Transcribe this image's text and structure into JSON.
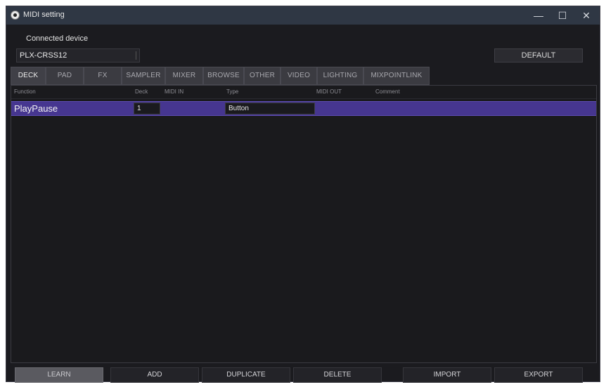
{
  "window": {
    "title": "MIDI setting",
    "controls": {
      "minimize": "—",
      "maximize": "☐",
      "close": "✕"
    }
  },
  "device": {
    "label": "Connected device",
    "value": "PLX-CRSS12",
    "default_button": "DEFAULT"
  },
  "tabs": [
    "DECK",
    "PAD",
    "FX",
    "SAMPLER",
    "MIXER",
    "BROWSE",
    "OTHER",
    "VIDEO",
    "LIGHTING",
    "MIXPOINTLINK"
  ],
  "active_tab": "DECK",
  "table": {
    "columns": [
      "Function",
      "Deck",
      "MIDI IN",
      "Type",
      "MIDI OUT",
      "Comment"
    ],
    "rows": [
      {
        "function": "PlayPause",
        "deck": "1",
        "midi_in": "",
        "type": "Button",
        "midi_out": "",
        "comment": ""
      }
    ]
  },
  "buttons": {
    "learn": "LEARN",
    "add": "ADD",
    "duplicate": "DUPLICATE",
    "delete": "DELETE",
    "import": "IMPORT",
    "export": "EXPORT"
  },
  "colors": {
    "selected_row": "#463690",
    "titlebar": "#2f3744",
    "background": "#1b1b1f"
  }
}
